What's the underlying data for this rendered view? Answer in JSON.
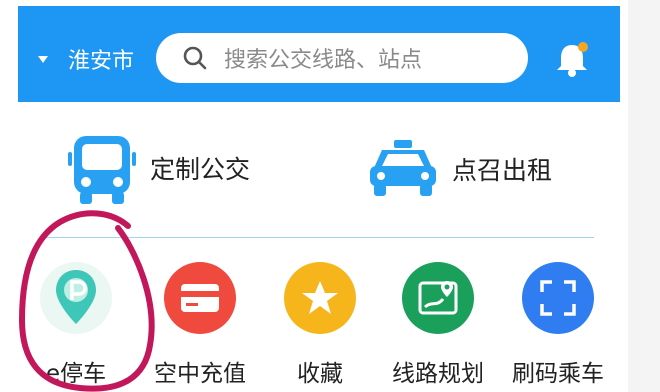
{
  "header": {
    "city": "淮安市",
    "search_placeholder": "搜索公交线路、站点"
  },
  "features": [
    {
      "label": "定制公交",
      "icon": "bus-icon"
    },
    {
      "label": "点召出租",
      "icon": "taxi-icon"
    }
  ],
  "apps": [
    {
      "label": "e停车",
      "icon": "parking-pin-icon",
      "color": "#3ec7b8"
    },
    {
      "label": "空中充值",
      "icon": "card-icon",
      "color": "#f04a3e"
    },
    {
      "label": "收藏",
      "icon": "star-icon",
      "color": "#f7b51c"
    },
    {
      "label": "线路规划",
      "icon": "route-map-icon",
      "color": "#1aa05a"
    },
    {
      "label": "刷码乘车",
      "icon": "scan-icon",
      "color": "#2f7df0"
    }
  ],
  "colors": {
    "header_bg": "#1e96f3",
    "accent": "#29a1f2",
    "annotation": "#c2185b",
    "badge": "#f5a623"
  }
}
